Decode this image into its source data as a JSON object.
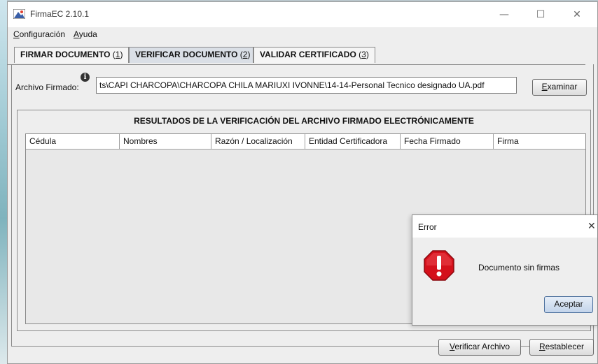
{
  "window": {
    "title": "FirmaEC 2.10.1"
  },
  "menu": [
    {
      "mnemonic": "C",
      "rest": "onfiguración"
    },
    {
      "mnemonic": "A",
      "rest": "yuda"
    }
  ],
  "tabs": [
    {
      "label": "FIRMAR DOCUMENTO",
      "shortcut": "1",
      "active": false
    },
    {
      "label": "VERIFICAR DOCUMENTO",
      "shortcut": "2",
      "active": true
    },
    {
      "label": "VALIDAR CERTIFICADO",
      "shortcut": "3",
      "active": false
    }
  ],
  "file": {
    "label": "Archivo Firmado:",
    "info_glyph": "i",
    "value": "ts\\CAPI CHARCOPA\\CHARCOPA CHILA MARIUXI IVONNE\\14-14-Personal Tecnico designado UA.pdf",
    "browse_mnemonic": "E",
    "browse_rest": "xaminar"
  },
  "results": {
    "title": "RESULTADOS DE LA VERIFICACIÓN DEL ARCHIVO FIRMADO ELECTRÓNICAMENTE",
    "columns": [
      "Cédula",
      "Nombres",
      "Razón / Localización",
      "Entidad Certificadora",
      "Fecha Firmado",
      "Firma"
    ]
  },
  "actions": {
    "verify_mnemonic": "V",
    "verify_rest": "erificar Archivo",
    "reset_mnemonic": "R",
    "reset_rest": "establecer"
  },
  "dialog": {
    "title": "Error",
    "close": "✕",
    "message": "Documento sin firmas",
    "button": "Aceptar"
  },
  "colors": {
    "stop_red": "#d4101b",
    "tab_active": "#dadfe6"
  }
}
